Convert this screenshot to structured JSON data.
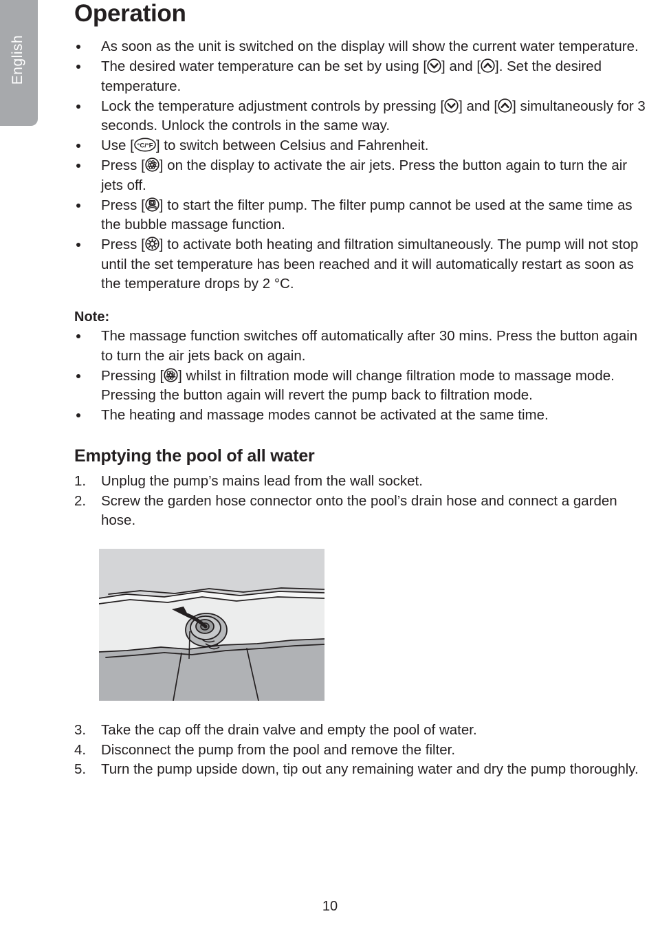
{
  "sidebar": {
    "language_tab": "English"
  },
  "page": {
    "title": "Operation",
    "page_number": "10"
  },
  "operation": {
    "bullets": [
      {
        "id": "display-shows-temp",
        "parts": [
          {
            "text": "As soon as the unit is switched on the display will show the current water temperature."
          }
        ]
      },
      {
        "id": "set-desired-temp",
        "parts": [
          {
            "text": "The desired water temperature can be set by using ["
          },
          {
            "icon": "chevron-down-circle-icon"
          },
          {
            "text": "] and ["
          },
          {
            "icon": "chevron-up-circle-icon"
          },
          {
            "text": "]. Set the desired temperature."
          }
        ]
      },
      {
        "id": "lock-controls",
        "parts": [
          {
            "text": "Lock the temperature adjustment controls by pressing ["
          },
          {
            "icon": "chevron-down-circle-icon"
          },
          {
            "text": "] and ["
          },
          {
            "icon": "chevron-up-circle-icon"
          },
          {
            "text": "] simultaneously for 3 seconds. Unlock the controls in the same way."
          }
        ]
      },
      {
        "id": "celsius-fahrenheit",
        "parts": [
          {
            "text": "Use ["
          },
          {
            "icon": "celsius-fahrenheit-icon"
          },
          {
            "text": "] to switch between Celsius and Fahrenheit."
          }
        ]
      },
      {
        "id": "air-jets",
        "parts": [
          {
            "text": "Press ["
          },
          {
            "icon": "bubble-massage-icon"
          },
          {
            "text": "] on the display to activate the air jets. Press the button again to turn the air jets off."
          }
        ]
      },
      {
        "id": "filter-pump",
        "parts": [
          {
            "text": "Press ["
          },
          {
            "icon": "filter-pump-icon"
          },
          {
            "text": "] to start the filter pump. The filter pump cannot be used at the same time as the bubble massage function."
          }
        ]
      },
      {
        "id": "heating-filtration",
        "parts": [
          {
            "text": "Press ["
          },
          {
            "icon": "heating-icon"
          },
          {
            "text": "] to activate both heating and filtration simultaneously. The pump will not stop until the set temperature has been reached and it will automatically restart as soon as the temperature drops by 2 °C."
          }
        ]
      }
    ]
  },
  "note": {
    "title": "Note:",
    "bullets": [
      {
        "id": "massage-auto-off",
        "parts": [
          {
            "text": "The massage function switches off automatically after 30 mins. Press the button again to turn the air jets back on again."
          }
        ]
      },
      {
        "id": "filtration-to-massage",
        "parts": [
          {
            "text": "Pressing ["
          },
          {
            "icon": "bubble-massage-icon"
          },
          {
            "text": "] whilst in filtration mode will change filtration mode to massage mode. Pressing the button again will revert the pump back to filtration mode."
          }
        ]
      },
      {
        "id": "heating-massage-exclusive",
        "parts": [
          {
            "text": "The heating and massage modes cannot be activated at the same time."
          }
        ]
      }
    ]
  },
  "emptying": {
    "title": "Emptying the pool of all water",
    "steps_before_image": [
      {
        "num": "1.",
        "text": "Unplug the pump’s mains lead from the wall socket."
      },
      {
        "num": "2.",
        "text": "Screw  the garden hose connector onto the pool’s drain hose and connect a garden hose."
      }
    ],
    "steps_after_image": [
      {
        "num": "3.",
        "text": "Take the cap off the drain valve and empty the pool of water."
      },
      {
        "num": "4.",
        "text": "Disconnect the pump from the pool and remove the filter."
      },
      {
        "num": "5.",
        "text": "Turn the pump upside down, tip out any remaining water and dry the pump thoroughly."
      }
    ]
  },
  "illustration": {
    "name": "pool-drain-valve-diagram",
    "description": "Line drawing of a pool wall drain valve with an arrow showing the cap being unscrewed and pulled away",
    "background_color": "#d4d5d7"
  },
  "colors": {
    "text": "#231f20",
    "tab_gray": "#a7a9ac",
    "illustration_bg": "#d4d5d7"
  }
}
